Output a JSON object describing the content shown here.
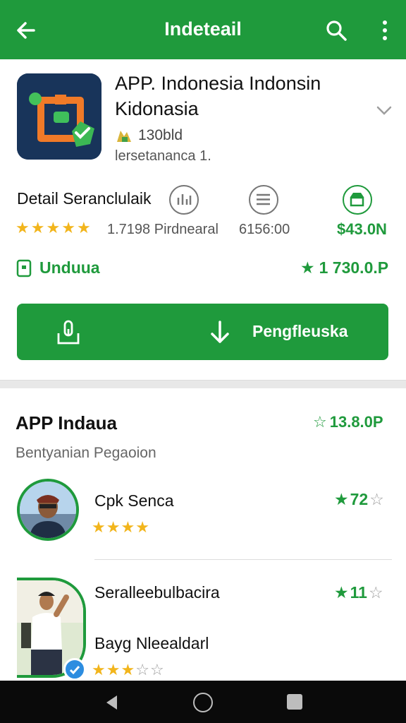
{
  "appbar": {
    "title": "Indeteail",
    "back_icon": "arrow-left-icon",
    "search_icon": "search-icon",
    "more_icon": "more-vertical-icon",
    "color": "#1f9a3c"
  },
  "app": {
    "name": "APP. Indonesia Indonsin Kidonasia",
    "downloads": "130bld",
    "developer": "lersetananca 1."
  },
  "details": {
    "title": "Detail Seranclulaik",
    "rating_stars": 4.5,
    "reviews_text": "1.7198 Pirdnearal",
    "size_text": "6156:00",
    "price": "$43.0N",
    "icons": [
      "bar-chart-icon",
      "list-icon",
      "shop-icon"
    ]
  },
  "unduh": {
    "label": "Unduua",
    "rating": "1 730.0.P"
  },
  "install_button": {
    "label": "Pengfleuska"
  },
  "reviews_section": {
    "title": "APP Indaua",
    "rating": "13.8.0P",
    "subtitle": "Bentyanian Pegaoion",
    "items": [
      {
        "name": "Cpk Senca",
        "stars": 3.5,
        "rating": "72"
      },
      {
        "name": "Seralleebulbacira",
        "subname": "Bayg Nleealdarl",
        "stars": 2.5,
        "rating": "11"
      }
    ]
  },
  "navbar": {
    "back_icon": "nav-back-icon",
    "home_icon": "nav-home-icon",
    "recent_icon": "nav-recent-icon"
  }
}
